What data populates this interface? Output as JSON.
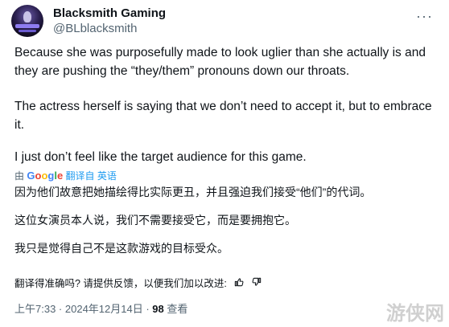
{
  "author": {
    "name": "Blacksmith Gaming",
    "handle": "@BLblacksmith",
    "more_icon": "ellipsis-icon"
  },
  "tweet": {
    "paragraphs": [
      "Because she was purposefully made to look uglier than she actually is and they are pushing the “they/them” pronouns down our throats.",
      "The actress herself is saying that we don’t need to accept it, but to embrace it.",
      "I just don’t feel like the target audience for this game."
    ]
  },
  "translation": {
    "by": "由",
    "google": "Google",
    "translated_from": "翻译自 英语",
    "paragraphs": [
      "因为他们故意把她描绘得比实际更丑，并且强迫我们接受“他们”的代词。",
      "这位女演员本人说，我们不需要接受它，而是要拥抱它。",
      "我只是觉得自己不是这款游戏的目标受众。"
    ],
    "rating_prompt": "翻译得准确吗? 请提供反馈，以便我们加以改进:"
  },
  "meta": {
    "time": "上午7:33",
    "date": "2024年12月14日",
    "views_count": "98",
    "views_label": "查看"
  },
  "watermark": "游侠网"
}
